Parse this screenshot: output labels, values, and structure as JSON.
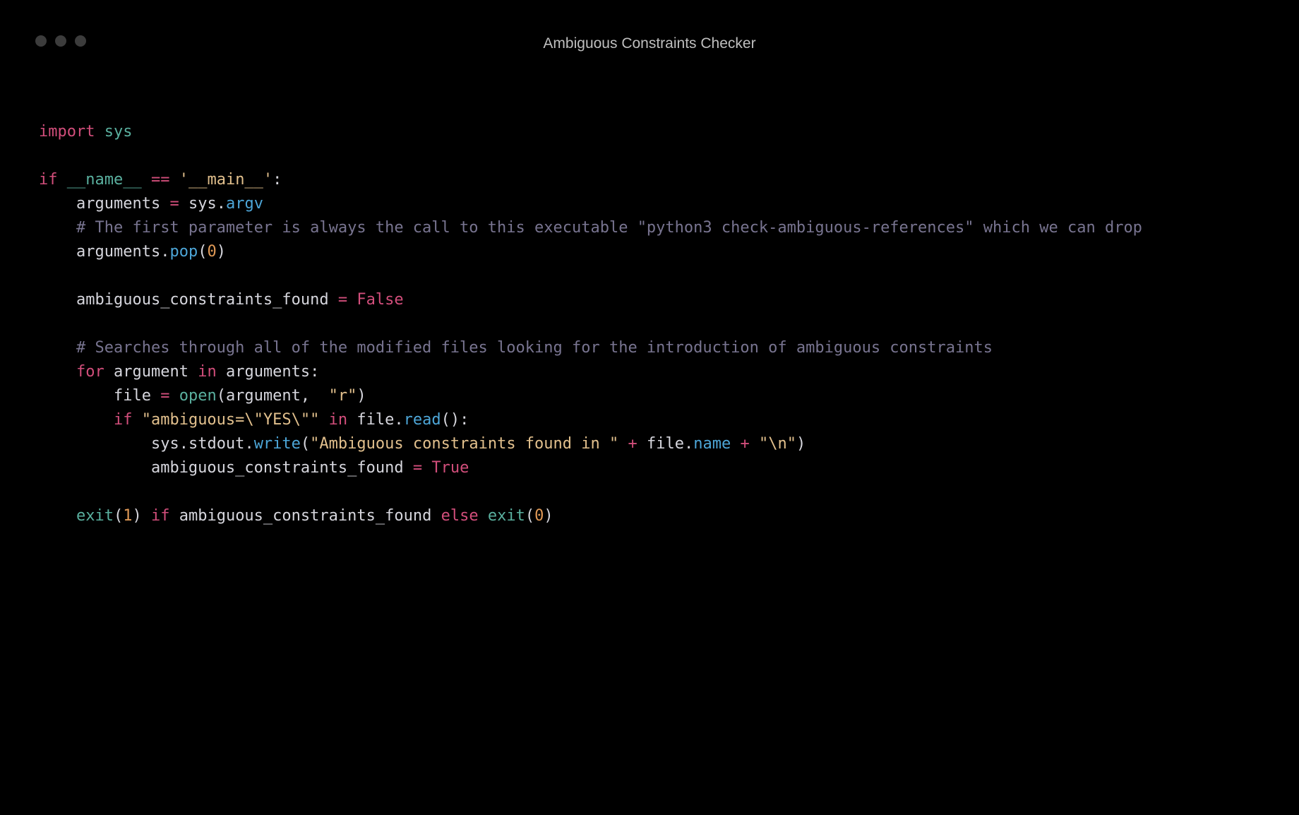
{
  "window": {
    "title": "Ambiguous Constraints Checker"
  },
  "code": {
    "tokens": [
      {
        "t": "import",
        "c": "tok-keyword"
      },
      {
        "t": " ",
        "c": ""
      },
      {
        "t": "sys",
        "c": "tok-module"
      },
      {
        "t": "\n",
        "c": ""
      },
      {
        "t": "\n",
        "c": ""
      },
      {
        "t": "if",
        "c": "tok-keyword"
      },
      {
        "t": " ",
        "c": ""
      },
      {
        "t": "__name__",
        "c": "tok-dunder"
      },
      {
        "t": " ",
        "c": ""
      },
      {
        "t": "==",
        "c": "tok-op"
      },
      {
        "t": " ",
        "c": ""
      },
      {
        "t": "'__main__'",
        "c": "tok-string"
      },
      {
        "t": ":",
        "c": "tok-punct"
      },
      {
        "t": "\n",
        "c": ""
      },
      {
        "t": "    ",
        "c": ""
      },
      {
        "t": "arguments",
        "c": "tok-ident"
      },
      {
        "t": " ",
        "c": ""
      },
      {
        "t": "=",
        "c": "tok-op"
      },
      {
        "t": " ",
        "c": ""
      },
      {
        "t": "sys",
        "c": "tok-ident"
      },
      {
        "t": ".",
        "c": "tok-punct"
      },
      {
        "t": "argv",
        "c": "tok-func"
      },
      {
        "t": "\n",
        "c": ""
      },
      {
        "t": "    ",
        "c": ""
      },
      {
        "t": "# The first parameter is always the call to this executable \"python3 check-ambiguous-references\" which we can drop",
        "c": "tok-comment"
      },
      {
        "t": "\n",
        "c": ""
      },
      {
        "t": "    ",
        "c": ""
      },
      {
        "t": "arguments",
        "c": "tok-ident"
      },
      {
        "t": ".",
        "c": "tok-punct"
      },
      {
        "t": "pop",
        "c": "tok-func"
      },
      {
        "t": "(",
        "c": "tok-punct"
      },
      {
        "t": "0",
        "c": "tok-num"
      },
      {
        "t": ")",
        "c": "tok-punct"
      },
      {
        "t": "\n",
        "c": ""
      },
      {
        "t": "\n",
        "c": ""
      },
      {
        "t": "    ",
        "c": ""
      },
      {
        "t": "ambiguous_constraints_found",
        "c": "tok-ident"
      },
      {
        "t": " ",
        "c": ""
      },
      {
        "t": "=",
        "c": "tok-op"
      },
      {
        "t": " ",
        "c": ""
      },
      {
        "t": "False",
        "c": "tok-bool"
      },
      {
        "t": "\n",
        "c": ""
      },
      {
        "t": "\n",
        "c": ""
      },
      {
        "t": "    ",
        "c": ""
      },
      {
        "t": "# Searches through all of the modified files looking for the introduction of ambiguous constraints",
        "c": "tok-comment"
      },
      {
        "t": "\n",
        "c": ""
      },
      {
        "t": "    ",
        "c": ""
      },
      {
        "t": "for",
        "c": "tok-keyword"
      },
      {
        "t": " ",
        "c": ""
      },
      {
        "t": "argument",
        "c": "tok-ident"
      },
      {
        "t": " ",
        "c": ""
      },
      {
        "t": "in",
        "c": "tok-keyword"
      },
      {
        "t": " ",
        "c": ""
      },
      {
        "t": "arguments",
        "c": "tok-ident"
      },
      {
        "t": ":",
        "c": "tok-punct"
      },
      {
        "t": "\n",
        "c": ""
      },
      {
        "t": "        ",
        "c": ""
      },
      {
        "t": "file",
        "c": "tok-ident"
      },
      {
        "t": " ",
        "c": ""
      },
      {
        "t": "=",
        "c": "tok-op"
      },
      {
        "t": " ",
        "c": ""
      },
      {
        "t": "open",
        "c": "tok-builtin"
      },
      {
        "t": "(",
        "c": "tok-punct"
      },
      {
        "t": "argument",
        "c": "tok-ident"
      },
      {
        "t": ",",
        "c": "tok-punct"
      },
      {
        "t": "  ",
        "c": ""
      },
      {
        "t": "\"r\"",
        "c": "tok-string"
      },
      {
        "t": ")",
        "c": "tok-punct"
      },
      {
        "t": "\n",
        "c": ""
      },
      {
        "t": "        ",
        "c": ""
      },
      {
        "t": "if",
        "c": "tok-keyword"
      },
      {
        "t": " ",
        "c": ""
      },
      {
        "t": "\"ambiguous=\\\"YES\\\"\"",
        "c": "tok-string"
      },
      {
        "t": " ",
        "c": ""
      },
      {
        "t": "in",
        "c": "tok-keyword"
      },
      {
        "t": " ",
        "c": ""
      },
      {
        "t": "file",
        "c": "tok-ident"
      },
      {
        "t": ".",
        "c": "tok-punct"
      },
      {
        "t": "read",
        "c": "tok-func"
      },
      {
        "t": "()",
        "c": "tok-punct"
      },
      {
        "t": ":",
        "c": "tok-punct"
      },
      {
        "t": "\n",
        "c": ""
      },
      {
        "t": "            ",
        "c": ""
      },
      {
        "t": "sys",
        "c": "tok-ident"
      },
      {
        "t": ".",
        "c": "tok-punct"
      },
      {
        "t": "stdout",
        "c": "tok-ident"
      },
      {
        "t": ".",
        "c": "tok-punct"
      },
      {
        "t": "write",
        "c": "tok-func"
      },
      {
        "t": "(",
        "c": "tok-punct"
      },
      {
        "t": "\"Ambiguous constraints found in \"",
        "c": "tok-string"
      },
      {
        "t": " ",
        "c": ""
      },
      {
        "t": "+",
        "c": "tok-op"
      },
      {
        "t": " ",
        "c": ""
      },
      {
        "t": "file",
        "c": "tok-ident"
      },
      {
        "t": ".",
        "c": "tok-punct"
      },
      {
        "t": "name",
        "c": "tok-func"
      },
      {
        "t": " ",
        "c": ""
      },
      {
        "t": "+",
        "c": "tok-op"
      },
      {
        "t": " ",
        "c": ""
      },
      {
        "t": "\"\\n\"",
        "c": "tok-string"
      },
      {
        "t": ")",
        "c": "tok-punct"
      },
      {
        "t": "\n",
        "c": ""
      },
      {
        "t": "            ",
        "c": ""
      },
      {
        "t": "ambiguous_constraints_found",
        "c": "tok-ident"
      },
      {
        "t": " ",
        "c": ""
      },
      {
        "t": "=",
        "c": "tok-op"
      },
      {
        "t": " ",
        "c": ""
      },
      {
        "t": "True",
        "c": "tok-bool"
      },
      {
        "t": "\n",
        "c": ""
      },
      {
        "t": "\n",
        "c": ""
      },
      {
        "t": "    ",
        "c": ""
      },
      {
        "t": "exit",
        "c": "tok-builtin"
      },
      {
        "t": "(",
        "c": "tok-punct"
      },
      {
        "t": "1",
        "c": "tok-num"
      },
      {
        "t": ")",
        "c": "tok-punct"
      },
      {
        "t": " ",
        "c": ""
      },
      {
        "t": "if",
        "c": "tok-keyword"
      },
      {
        "t": " ",
        "c": ""
      },
      {
        "t": "ambiguous_constraints_found",
        "c": "tok-ident"
      },
      {
        "t": " ",
        "c": ""
      },
      {
        "t": "else",
        "c": "tok-keyword"
      },
      {
        "t": " ",
        "c": ""
      },
      {
        "t": "exit",
        "c": "tok-builtin"
      },
      {
        "t": "(",
        "c": "tok-punct"
      },
      {
        "t": "0",
        "c": "tok-num"
      },
      {
        "t": ")",
        "c": "tok-punct"
      },
      {
        "t": "\n",
        "c": ""
      }
    ]
  }
}
